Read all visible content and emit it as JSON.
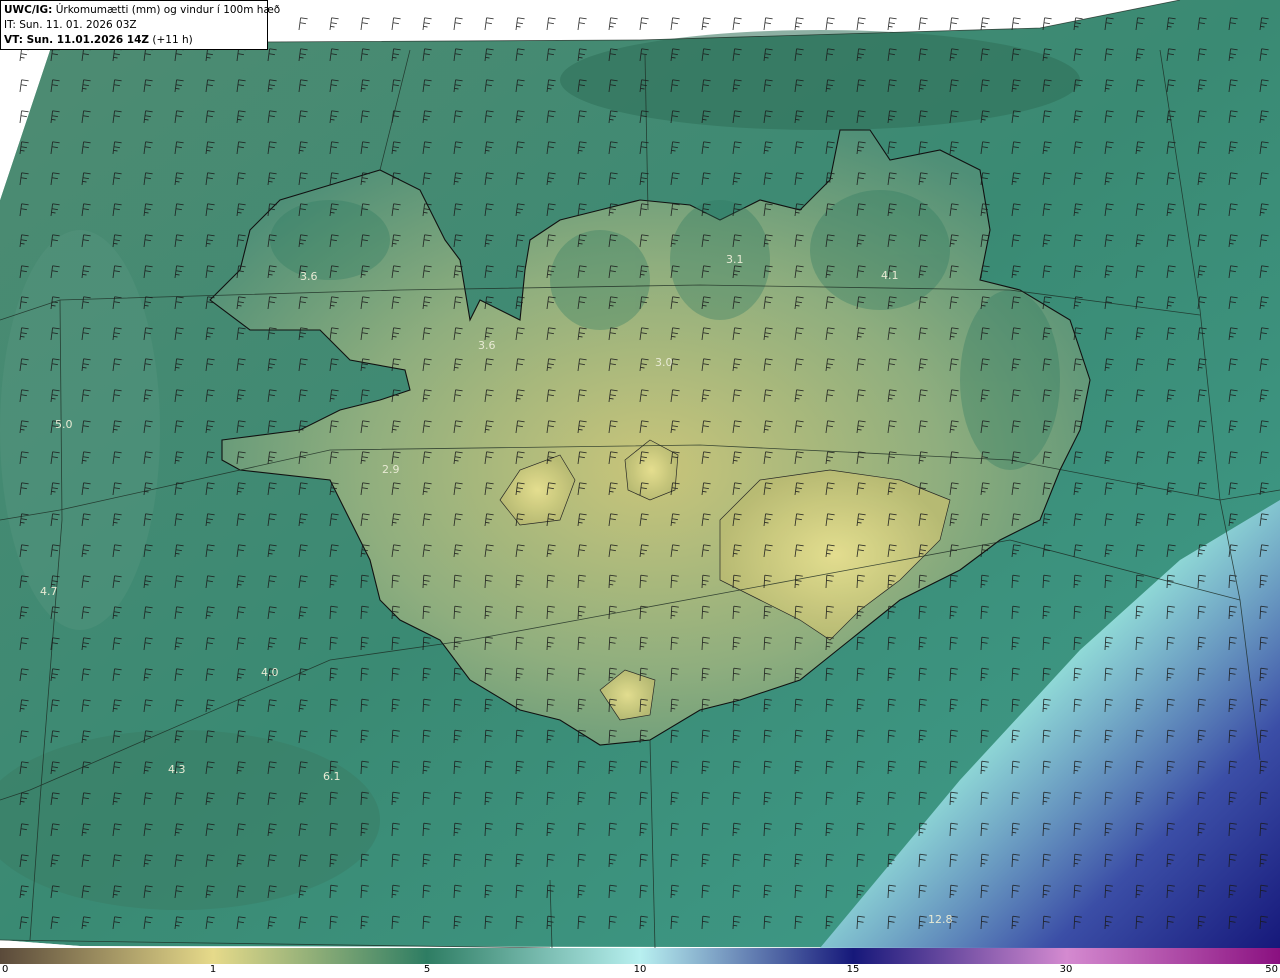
{
  "header": {
    "model": "UWC/IG:",
    "title": "Úrkomumætti (mm) og vindur í 100m hæð",
    "init_time": "IT: Sun. 11. 01. 2026 03Z",
    "valid_prefix": "VT: Sun. 11.01.2026 14Z",
    "valid_suffix": "(+11 h)"
  },
  "colors": {
    "sea": "#2f7a62",
    "land_low": "#c4c47a",
    "land_high": "#4f9178",
    "deep_precip": "#1a2a86",
    "coast": "#111111"
  },
  "colorbar": {
    "ticks": [
      "0",
      "1",
      "5",
      "10",
      "15",
      "30",
      "50"
    ],
    "stops": [
      {
        "value": 0,
        "color": "#5a4a3a"
      },
      {
        "value": 1,
        "color": "#e6da8a"
      },
      {
        "value": 5,
        "color": "#2e7d63"
      },
      {
        "value": 10,
        "color": "#b8f0f0"
      },
      {
        "value": 15,
        "color": "#16187a"
      },
      {
        "value": 30,
        "color": "#d48ad0"
      },
      {
        "value": 50,
        "color": "#8a1080"
      }
    ]
  },
  "values": [
    {
      "text": "3.6"
    },
    {
      "text": "3.6"
    },
    {
      "text": "3.1"
    },
    {
      "text": "4.1"
    },
    {
      "text": "3.0"
    },
    {
      "text": "5.0"
    },
    {
      "text": "2.9"
    },
    {
      "text": "4.7"
    },
    {
      "text": "4.0"
    },
    {
      "text": "4.3"
    },
    {
      "text": "6.1"
    },
    {
      "text": "12.8"
    }
  ]
}
